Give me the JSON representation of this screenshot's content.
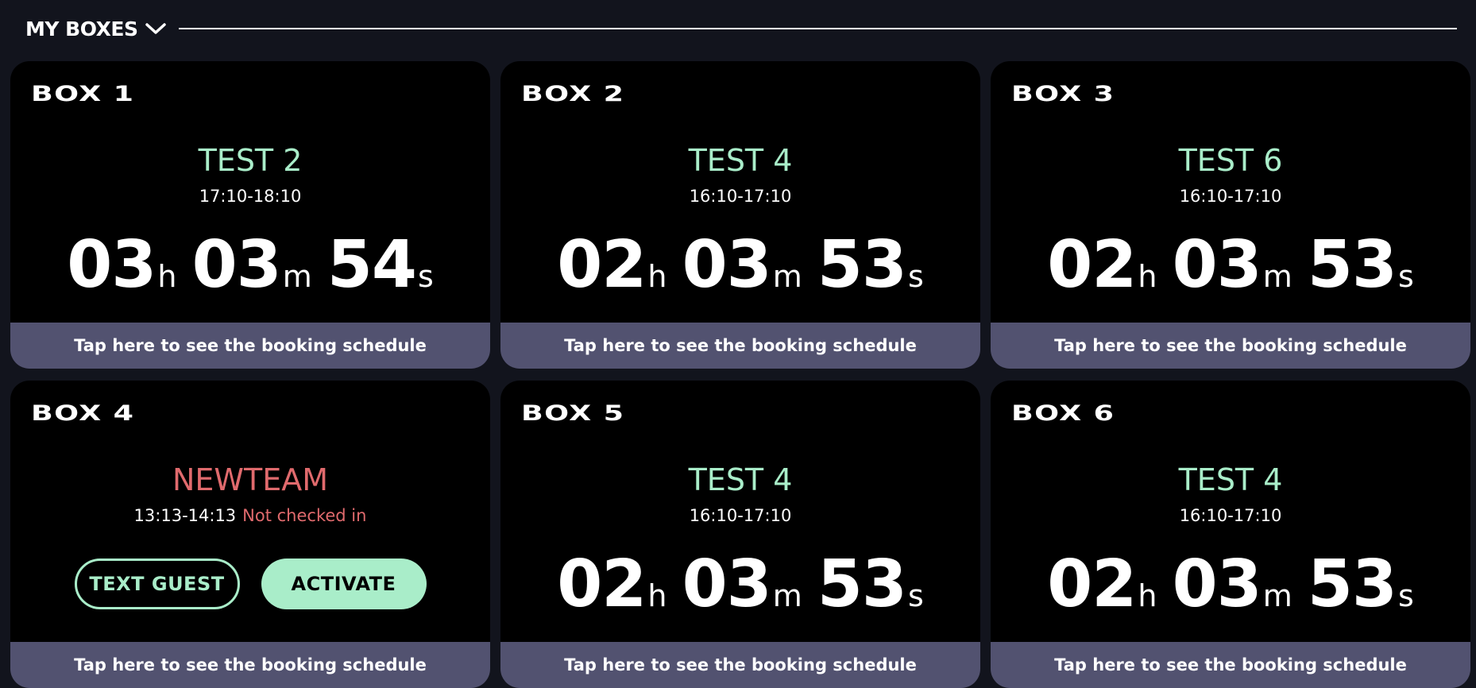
{
  "header": {
    "title": "MY BOXES"
  },
  "boxes": [
    {
      "label": "BOX 1",
      "team": "TEST 2",
      "time_range": "17:10-18:10",
      "countdown": {
        "hours": "03",
        "minutes": "03",
        "seconds": "54"
      },
      "footer": "Tap here to see the booking schedule"
    },
    {
      "label": "BOX 2",
      "team": "TEST 4",
      "time_range": "16:10-17:10",
      "countdown": {
        "hours": "02",
        "minutes": "03",
        "seconds": "53"
      },
      "footer": "Tap here to see the booking schedule"
    },
    {
      "label": "BOX 3",
      "team": "TEST 6",
      "time_range": "16:10-17:10",
      "countdown": {
        "hours": "02",
        "minutes": "03",
        "seconds": "53"
      },
      "footer": "Tap here to see the booking schedule"
    },
    {
      "label": "BOX 4",
      "team": "NEWTEAM",
      "time_range": "13:13-14:13",
      "status": "Not checked in",
      "actions": {
        "text_guest": "TEXT GUEST",
        "activate": "ACTIVATE"
      },
      "footer": "Tap here to see the booking schedule"
    },
    {
      "label": "BOX 5",
      "team": "TEST 4",
      "time_range": "16:10-17:10",
      "countdown": {
        "hours": "02",
        "minutes": "03",
        "seconds": "53"
      },
      "footer": "Tap here to see the booking schedule"
    },
    {
      "label": "BOX 6",
      "team": "TEST 4",
      "time_range": "16:10-17:10",
      "countdown": {
        "hours": "02",
        "minutes": "03",
        "seconds": "53"
      },
      "footer": "Tap here to see the booking schedule"
    }
  ],
  "units": {
    "hours": "h",
    "minutes": "m",
    "seconds": "s"
  },
  "icons": {
    "header_toggle": "chevron-down-icon"
  },
  "colors": {
    "background": "#12141d",
    "card": "#000000",
    "team_active": "#a9edc9",
    "team_alert": "#e06a6d",
    "footer": "#525270",
    "accent": "#a9edc9"
  }
}
